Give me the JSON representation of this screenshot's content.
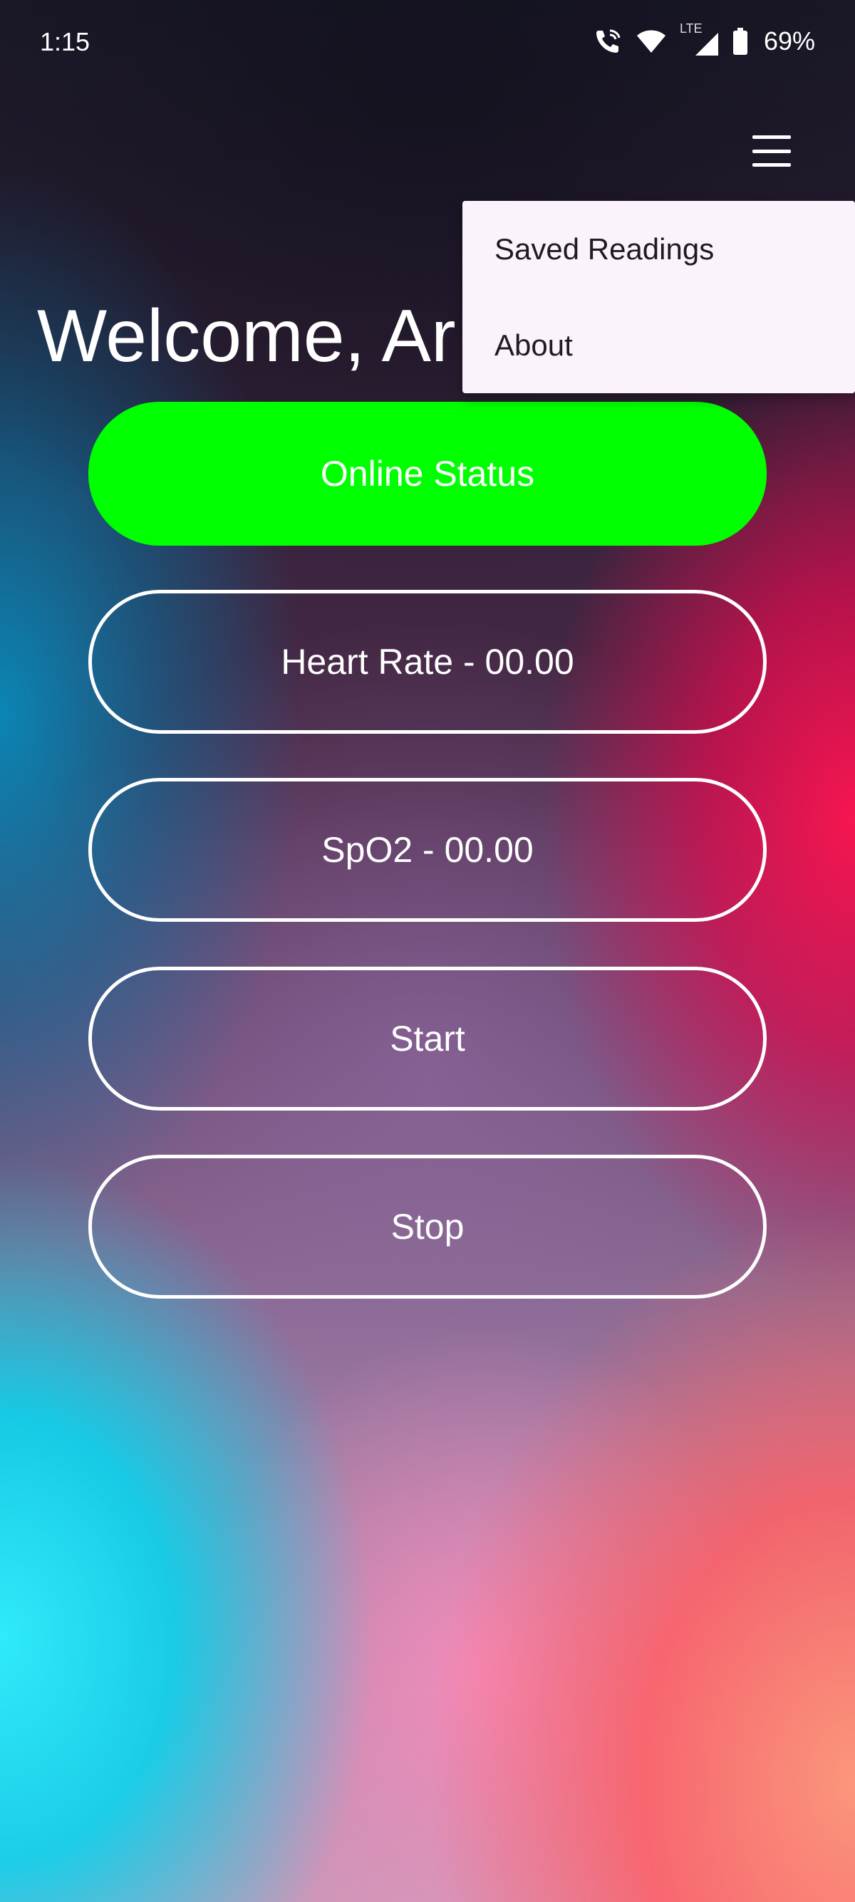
{
  "status_bar": {
    "time": "1:15",
    "battery": "69%",
    "network": "LTE",
    "icons": [
      "wifi-calling-icon",
      "wifi-icon",
      "signal-icon",
      "battery-icon"
    ]
  },
  "app": {
    "welcome_text": "Welcome, Ar",
    "menu_icon": "hamburger-menu-icon"
  },
  "menu": {
    "items": [
      {
        "label": "Saved Readings"
      },
      {
        "label": "About"
      }
    ]
  },
  "buttons": {
    "online_status": "Online Status",
    "heart_rate": "Heart Rate - 00.00",
    "spo2": "SpO2 - 00.00",
    "start": "Start",
    "stop": "Stop"
  },
  "colors": {
    "online_status_bg": "#00ff00",
    "menu_bg": "#fbf3fb",
    "menu_text": "#1f1a24"
  }
}
